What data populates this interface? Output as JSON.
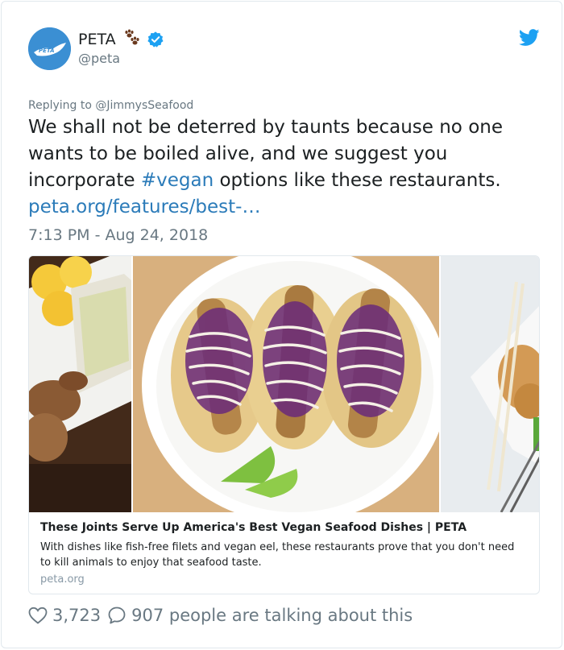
{
  "author": {
    "display_name": "PETA",
    "handle": "@peta",
    "avatar_text": "PETA",
    "paw_icon": "paw-prints-icon",
    "verified_icon": "verified-badge-icon"
  },
  "reply_to": "Replying to @JimmysSeafood",
  "tweet": {
    "text_before": "We shall not be deterred by taunts because no one wants to be boiled alive, and we suggest you incorporate ",
    "hashtag": "#vegan",
    "text_after": " options like these restaurants. ",
    "link_text": "peta.org/features/best-…"
  },
  "timestamp": "7:13 PM - Aug 24, 2018",
  "link_card": {
    "title": "These Joints Serve Up America's Best Vegan Seafood Dishes | PETA",
    "description": "With dishes like fish-free filets and vegan eel, these restaurants prove that you don't need to kill animals to enjoy that seafood taste.",
    "domain": "peta.org"
  },
  "actions": {
    "like_count": "3,723",
    "talking_text": "907 people are talking about this"
  },
  "colors": {
    "link": "#2b7bb9",
    "twitter_blue": "#1da1f2",
    "muted": "#697882",
    "avatar_bg": "#3b8fd3"
  }
}
